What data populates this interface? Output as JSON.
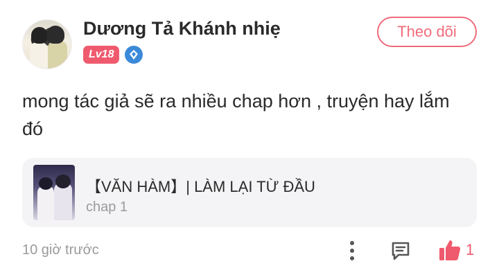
{
  "user": {
    "name": "Dương Tả Khánh nhiẹ",
    "level": "Lv18",
    "follow_label": "Theo dõi"
  },
  "comment": {
    "text": "mong tác giả sẽ ra nhiều chap hơn , truyện hay lắm đó"
  },
  "story": {
    "title": "【VĂN HÀM】| LÀM LẠI TỪ ĐẦU",
    "chapter": "chap 1"
  },
  "footer": {
    "timestamp": "10 giờ trước",
    "like_count": "1"
  },
  "icons": {
    "vip": "diamond-badge-icon",
    "more": "more-vertical-icon",
    "reply": "comment-reply-icon",
    "like": "thumbs-up-icon"
  },
  "colors": {
    "accent": "#f05a6e",
    "follow_border": "#f06b7b",
    "vip_badge": "#3b8ad9",
    "muted_text": "#9a9a9a",
    "card_bg": "#f4f4f6"
  }
}
